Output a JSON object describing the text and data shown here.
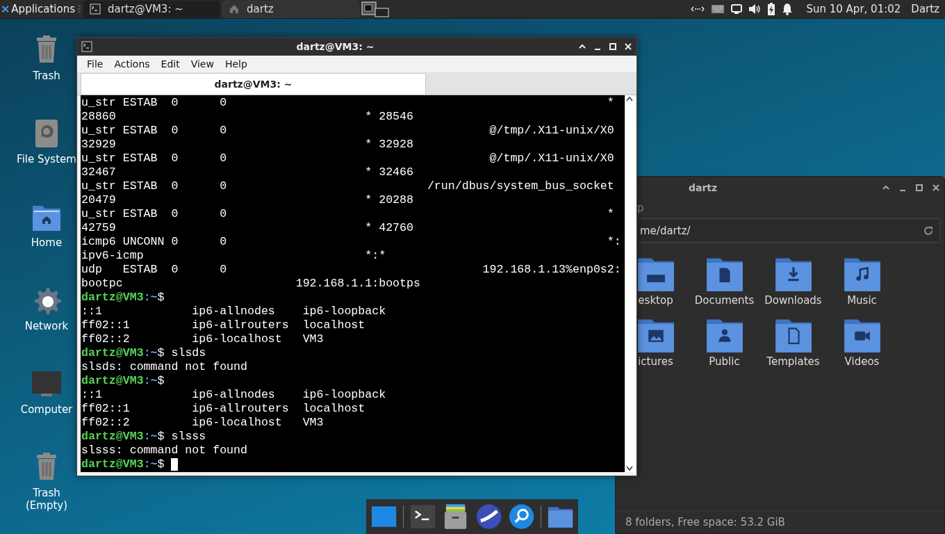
{
  "top_panel": {
    "applications": "Applications",
    "tasks": [
      {
        "label": "dartz@VM3: ~",
        "kind": "terminal",
        "selected": true
      },
      {
        "label": "dartz",
        "kind": "home",
        "selected": false
      }
    ],
    "clock": "Sun 10 Apr, 01:02",
    "user": "Dartz"
  },
  "desktop_icons": [
    {
      "label": "Trash",
      "kind": "trash"
    },
    {
      "label": "File System",
      "kind": "drive"
    },
    {
      "label": "Home",
      "kind": "home"
    },
    {
      "label": "Network",
      "kind": "network"
    },
    {
      "label": "Computer",
      "kind": "computer"
    },
    {
      "label": "Trash (Empty)",
      "kind": "trash"
    }
  ],
  "terminal_window": {
    "title": "dartz@VM3: ~",
    "menu": [
      "File",
      "Actions",
      "Edit",
      "View",
      "Help"
    ],
    "tabs": [
      {
        "label": "dartz@VM3: ~",
        "selected": true
      }
    ],
    "lines": [
      {
        "kind": "output",
        "text": "u_str ESTAB  0      0                                                       *"
      },
      {
        "kind": "output",
        "text": "28860                                    * 28546"
      },
      {
        "kind": "output",
        "text": "u_str ESTAB  0      0                                      @/tmp/.X11-unix/X0"
      },
      {
        "kind": "output",
        "text": "32929                                    * 32928"
      },
      {
        "kind": "output",
        "text": "u_str ESTAB  0      0                                      @/tmp/.X11-unix/X0"
      },
      {
        "kind": "output",
        "text": "32467                                    * 32466"
      },
      {
        "kind": "output",
        "text": "u_str ESTAB  0      0                             /run/dbus/system_bus_socket"
      },
      {
        "kind": "output",
        "text": "20479                                    * 20288"
      },
      {
        "kind": "output",
        "text": "u_str ESTAB  0      0                                                       *"
      },
      {
        "kind": "output",
        "text": "42759                                    * 42760"
      },
      {
        "kind": "output",
        "text": "icmp6 UNCONN 0      0                                                       *:"
      },
      {
        "kind": "output",
        "text": "ipv6-icmp                                *:*"
      },
      {
        "kind": "output",
        "text": "udp   ESTAB  0      0                                     192.168.1.13%enp0s2:"
      },
      {
        "kind": "output",
        "text": "bootpc                         192.168.1.1:bootps"
      },
      {
        "kind": "prompt",
        "user": "dartz@VM3",
        "dir": ":~",
        "text": "$"
      },
      {
        "kind": "output",
        "text": "::1             ip6-allnodes    ip6-loopback"
      },
      {
        "kind": "output",
        "text": "ff02::1         ip6-allrouters  localhost"
      },
      {
        "kind": "output",
        "text": "ff02::2         ip6-localhost   VM3"
      },
      {
        "kind": "prompt",
        "user": "dartz@VM3",
        "dir": ":~",
        "text": "$ slsds"
      },
      {
        "kind": "output",
        "text": "slsds: command not found"
      },
      {
        "kind": "prompt",
        "user": "dartz@VM3",
        "dir": ":~",
        "text": "$"
      },
      {
        "kind": "output",
        "text": "::1             ip6-allnodes    ip6-loopback"
      },
      {
        "kind": "output",
        "text": "ff02::1         ip6-allrouters  localhost"
      },
      {
        "kind": "output",
        "text": "ff02::2         ip6-localhost   VM3"
      },
      {
        "kind": "prompt",
        "user": "dartz@VM3",
        "dir": ":~",
        "text": "$ slsss"
      },
      {
        "kind": "output",
        "text": "slsss: command not found"
      },
      {
        "kind": "prompt",
        "user": "dartz@VM3",
        "dir": ":~",
        "text": "$ ",
        "cursor": true
      }
    ]
  },
  "file_manager": {
    "title": "dartz",
    "menu_fragment": "p",
    "path": "me/dartz/",
    "folders": [
      {
        "label": "esktop",
        "kind": "desktop"
      },
      {
        "label": "Documents",
        "kind": "documents"
      },
      {
        "label": "Downloads",
        "kind": "downloads"
      },
      {
        "label": "Music",
        "kind": "music"
      },
      {
        "label": "ictures",
        "kind": "pictures"
      },
      {
        "label": "Public",
        "kind": "public"
      },
      {
        "label": "Templates",
        "kind": "templates"
      },
      {
        "label": "Videos",
        "kind": "videos"
      }
    ],
    "status": "8 folders, Free space: 53.2 GiB"
  }
}
